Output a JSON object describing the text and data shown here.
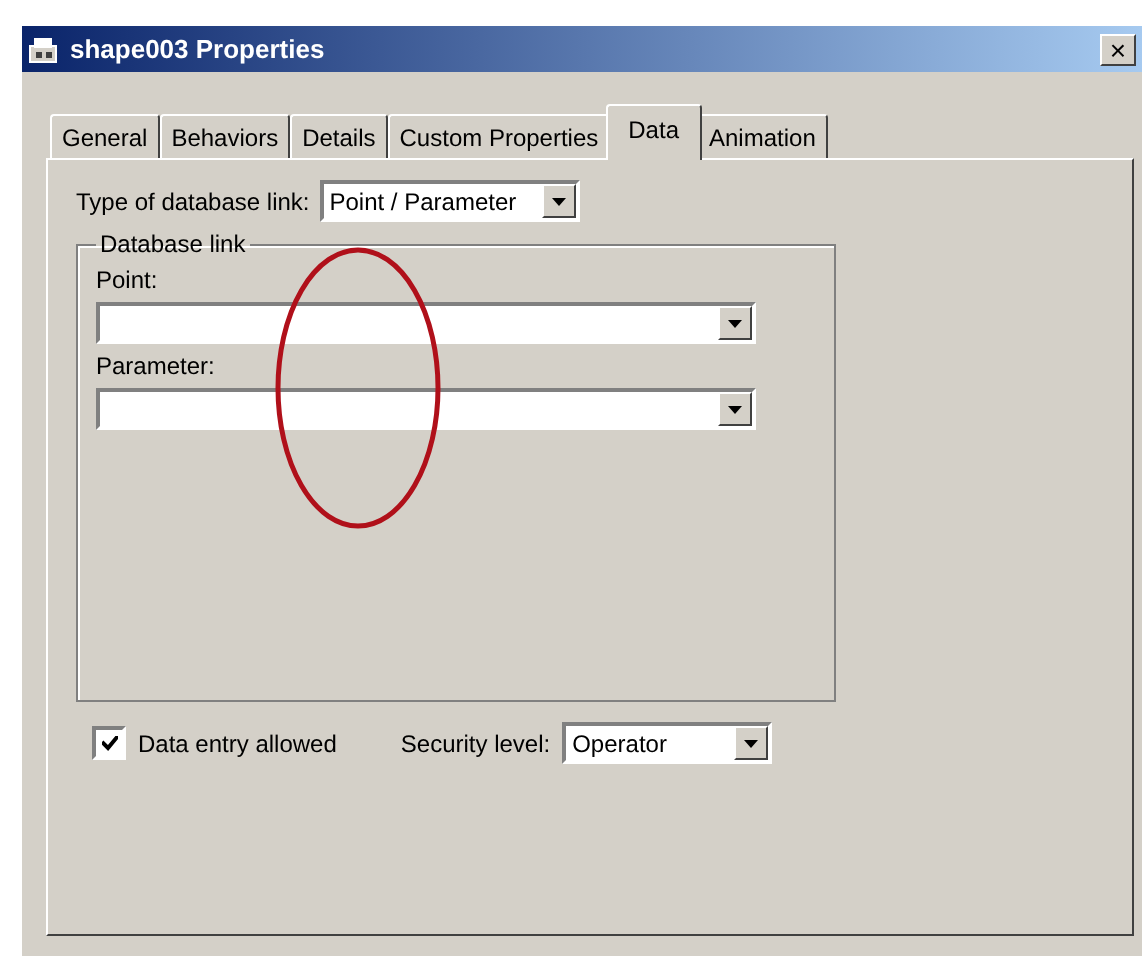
{
  "window": {
    "title": "shape003 Properties",
    "close": "×"
  },
  "tabs": [
    {
      "label": "General",
      "selected": false
    },
    {
      "label": "Behaviors",
      "selected": false
    },
    {
      "label": "Details",
      "selected": false
    },
    {
      "label": "Custom Properties",
      "selected": false
    },
    {
      "label": "Data",
      "selected": true
    },
    {
      "label": "Animation",
      "selected": false
    }
  ],
  "link_type": {
    "label": "Type of database link:",
    "value": "Point / Parameter"
  },
  "database_link": {
    "title": "Database link",
    "fields": [
      {
        "label": "Point:"
      },
      {
        "label": "Parameter:"
      }
    ]
  },
  "data_entry": {
    "label": "Data entry allowed",
    "checked": true
  },
  "security_level": {
    "label": "Security level:",
    "value": "Operator"
  }
}
